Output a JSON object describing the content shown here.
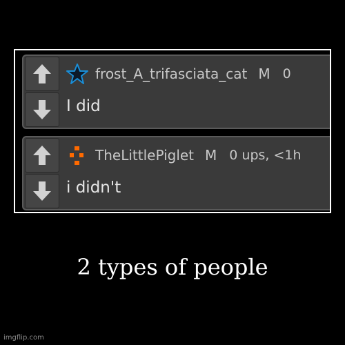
{
  "colors": {
    "background": "#000000",
    "frame_border": "#ffffff",
    "comment_bg": "#3a3a3a",
    "vote_button_bg": "#454545",
    "vote_arrow": "#d2d2d2",
    "star_outline": "#1a8fd8",
    "piglet_orange": "#ff6a00",
    "text_primary": "#e6e6e6",
    "text_secondary": "#c8c8c8"
  },
  "comments": [
    {
      "username": "frost_A_trifasciata_cat",
      "badge": "M",
      "meta": "0",
      "avatar_icon": "star-icon",
      "body": "I did",
      "upvote_icon": "arrow-up-icon",
      "downvote_icon": "arrow-down-icon"
    },
    {
      "username": "TheLittlePiglet",
      "badge": "M",
      "meta": "0 ups, <1h",
      "avatar_icon": "pixel-piglet-icon",
      "body": "i didn't",
      "upvote_icon": "arrow-up-icon",
      "downvote_icon": "arrow-down-icon"
    }
  ],
  "caption": "2 types of people",
  "watermark": "imgflip.com"
}
